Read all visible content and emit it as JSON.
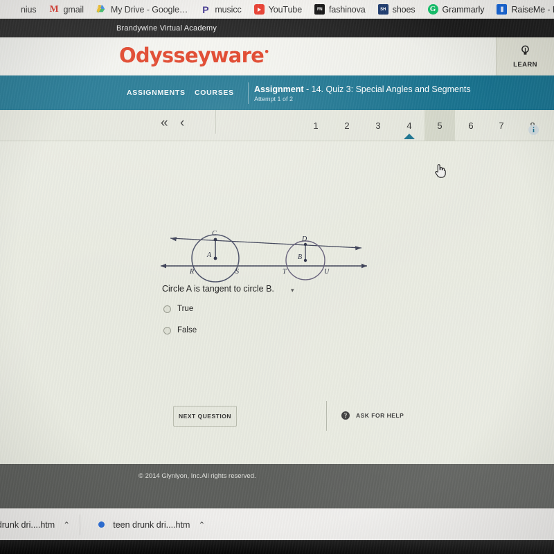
{
  "browser": {
    "bookmarks": [
      {
        "label": "nius",
        "icon": "generic-icon"
      },
      {
        "label": "gmail",
        "icon": "gmail-icon"
      },
      {
        "label": "My Drive - Google…",
        "icon": "google-drive-icon"
      },
      {
        "label": "musicc",
        "icon": "pandora-icon"
      },
      {
        "label": "YouTube",
        "icon": "youtube-icon"
      },
      {
        "label": "fashinova",
        "icon": "fashionnova-icon"
      },
      {
        "label": "shoes",
        "icon": "shoes-icon"
      },
      {
        "label": "Grammarly",
        "icon": "grammarly-icon"
      },
      {
        "label": "RaiseMe - Bl",
        "icon": "raiseme-icon"
      }
    ],
    "downloads": [
      {
        "name": "teen drunk dri....htm",
        "chevron": "⌃",
        "has_dot": false
      },
      {
        "name": "teen drunk dri....htm",
        "chevron": "⌃",
        "has_dot": true
      }
    ]
  },
  "school_bar": {
    "name": "Brandywine Virtual Academy"
  },
  "brand": {
    "logo_text": "Odysseyware",
    "logo_registered": "•",
    "logo_color": "#e03a1e",
    "learn_label": "LEARN",
    "learn_icon": "lightbulb-icon"
  },
  "navbar": {
    "accent_color": "#15708d",
    "tabs": [
      {
        "label": "ASSIGNMENTS"
      },
      {
        "label": "COURSES"
      }
    ],
    "assignment_prefix": "Assignment",
    "assignment_title": " - 14. Quiz 3: Special Angles and Segments",
    "attempt": "Attempt 1 of 2",
    "info_icon": "info-icon",
    "info_glyph": "i"
  },
  "pager": {
    "first_glyph": "«",
    "prev_glyph": "‹",
    "numbers": [
      "1",
      "2",
      "3",
      "4",
      "5",
      "6",
      "7",
      "8"
    ],
    "active_index": 4,
    "marker_index": 3,
    "marker_color": "#15708d",
    "cursor_glyph": "☟"
  },
  "question": {
    "prompt": "Circle A is tangent to circle B.",
    "caret_glyph": "▾",
    "options": [
      {
        "label": "True",
        "selected": false
      },
      {
        "label": "False",
        "selected": false
      }
    ],
    "diagram": {
      "alt": "two tangent circles with common tangent lines",
      "labels": [
        "C",
        "D",
        "A",
        "B",
        "R",
        "S",
        "T",
        "U"
      ],
      "circle_a_center_label": "A",
      "circle_b_center_label": "B"
    }
  },
  "actions": {
    "next_label": "NEXT QUESTION",
    "help_label": "ASK FOR HELP",
    "help_icon": "question-mark-icon",
    "help_glyph": "?"
  },
  "footer": {
    "copyright": "© 2014 Glynlyon, Inc.All rights reserved."
  }
}
